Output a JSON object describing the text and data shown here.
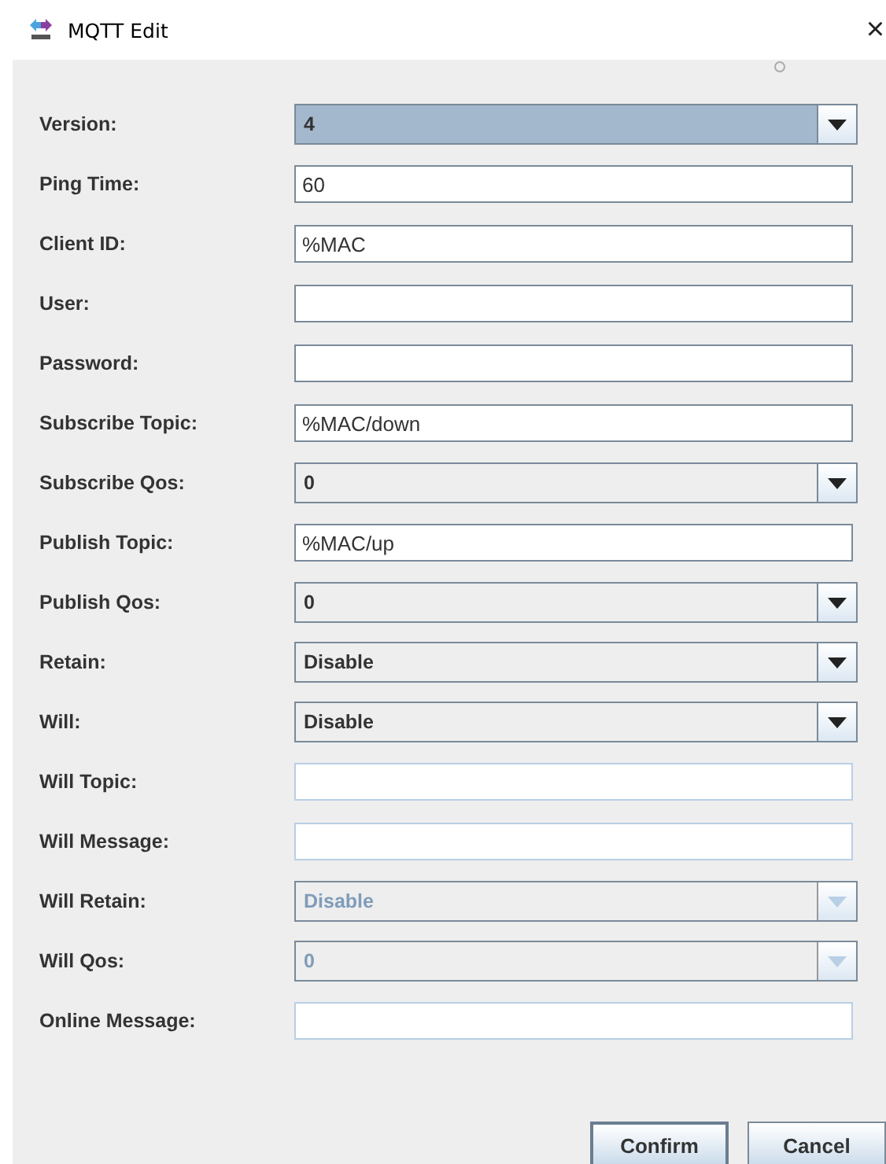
{
  "window": {
    "title": "MQTT Edit",
    "close": "×"
  },
  "fields": [
    {
      "label": "Version:",
      "kind": "combo",
      "value": "4",
      "focused": true,
      "disabled": false
    },
    {
      "label": "Ping Time:",
      "kind": "text",
      "value": "60",
      "disabled": false
    },
    {
      "label": "Client ID:",
      "kind": "text",
      "value": "%MAC",
      "disabled": false
    },
    {
      "label": "User:",
      "kind": "text",
      "disabled": false
    },
    {
      "label": "Password:",
      "kind": "password",
      "disabled": false
    },
    {
      "label": "Subscribe Topic:",
      "kind": "text",
      "value": "%MAC/down",
      "disabled": false
    },
    {
      "label": "Subscribe Qos:",
      "kind": "combo",
      "value": "0",
      "focused": false,
      "disabled": false
    },
    {
      "label": "Publish Topic:",
      "kind": "text",
      "value": "%MAC/up",
      "disabled": false
    },
    {
      "label": "Publish Qos:",
      "kind": "combo",
      "value": "0",
      "focused": false,
      "disabled": false
    },
    {
      "label": "Retain:",
      "kind": "combo",
      "value": "Disable",
      "focused": false,
      "disabled": false
    },
    {
      "label": "Will:",
      "kind": "combo",
      "value": "Disable",
      "focused": false,
      "disabled": false
    },
    {
      "label": "Will Topic:",
      "kind": "text",
      "disabled": true
    },
    {
      "label": "Will Message:",
      "kind": "text",
      "disabled": true
    },
    {
      "label": "Will Retain:",
      "kind": "combo",
      "value": "Disable",
      "focused": false,
      "disabled": true
    },
    {
      "label": "Will Qos:",
      "kind": "combo",
      "value": "0",
      "focused": false,
      "disabled": true
    },
    {
      "label": "Online Message:",
      "kind": "text",
      "disabled": true
    }
  ],
  "buttons": [
    {
      "label": "Confirm",
      "focused": true
    },
    {
      "label": "Cancel",
      "focused": false
    }
  ]
}
